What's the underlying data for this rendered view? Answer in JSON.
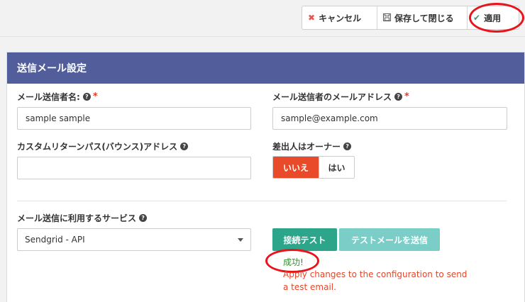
{
  "toolbar": {
    "cancel_label": "キャンセル",
    "save_close_label": "保存して閉じる",
    "apply_label": "適用"
  },
  "panel": {
    "title": "送信メール設定"
  },
  "fields": {
    "sender_name": {
      "label": "メール送信者名:",
      "value": "sample sample",
      "required": "*"
    },
    "sender_email": {
      "label": "メール送信者のメールアドレス",
      "value": "sample@example.com",
      "required": "*"
    },
    "return_path": {
      "label": "カスタムリターンパス(バウンス)アドレス",
      "value": ""
    },
    "from_owner": {
      "label": "差出人はオーナー",
      "options": [
        "いいえ",
        "はい"
      ],
      "selected": "いいえ"
    },
    "service": {
      "label": "メール送信に利用するサービス",
      "value": "Sendgrid - API"
    }
  },
  "actions": {
    "test_connection": "接続テスト",
    "send_test_mail": "テストメールを送信"
  },
  "status": {
    "success": "成功!",
    "note": "Apply changes to the configuration to send a test email."
  },
  "colors": {
    "header_bg": "#525e9b",
    "toggle_active": "#e94a2a",
    "test_button": "#2da58a",
    "send_button_disabled": "#7bcdc8",
    "highlight_circle": "#e8141c"
  }
}
